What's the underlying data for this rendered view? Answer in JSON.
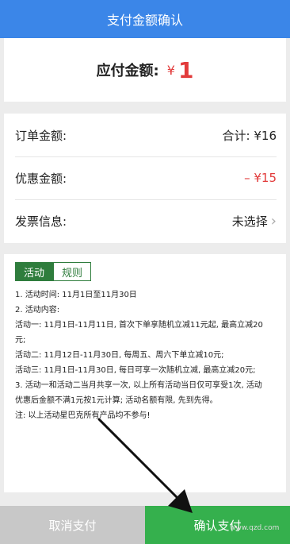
{
  "header": {
    "title": "支付金额确认"
  },
  "payable": {
    "label": "应付金额:",
    "currency": "¥",
    "value": "1"
  },
  "details": {
    "order": {
      "label": "订单金额:",
      "value": "合计: ¥16"
    },
    "discount": {
      "label": "优惠金额:",
      "value": "– ¥15"
    },
    "invoice": {
      "label": "发票信息:",
      "value": "未选择"
    }
  },
  "tabs": {
    "active": "活动",
    "inactive": "规则"
  },
  "rules": [
    "1. 活动时间: 11月1日至11月30日",
    "2. 活动内容:",
    "活动一: 11月1日-11月11日, 首次下单享随机立减11元起, 最高立减20",
    "元;",
    "活动二: 11月12日-11月30日, 每周五、周六下单立减10元;",
    "活动三: 11月1日-11月30日, 每日可享一次随机立减, 最高立减20元;",
    "3. 活动一和活动二当月共享一次, 以上所有活动当日仅可享受1次, 活动",
    "优惠后金额不满1元按1元计算; 活动名额有限, 先到先得。",
    "注: 以上活动星巴克所有产品均不参与!"
  ],
  "buttons": {
    "cancel": "取消支付",
    "confirm": "确认支付"
  },
  "watermark": "www.qzd.com",
  "colors": {
    "header": "#3b86e8",
    "confirm": "#35b04d",
    "cancel": "#c8c8c8",
    "price": "#e23b3b",
    "tab": "#2f7d3d"
  },
  "icons": {
    "chevron": "chevron-right-icon",
    "arrow": "annotation-arrow-icon"
  }
}
